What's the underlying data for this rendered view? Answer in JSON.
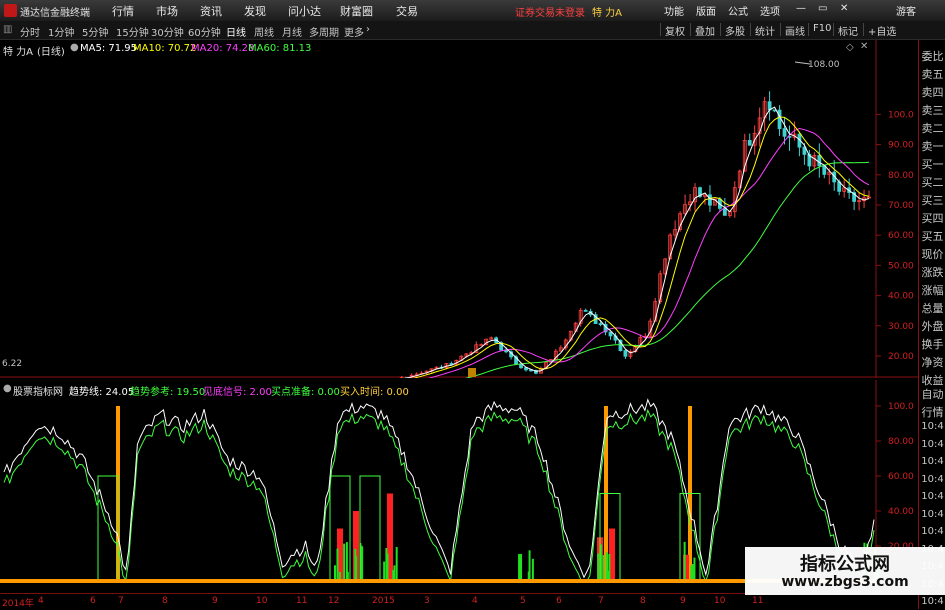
{
  "titlebar": {
    "app_name": "通达信金融终端",
    "menus": [
      "行情",
      "市场",
      "资讯",
      "发现",
      "问小达",
      "财富圈",
      "交易"
    ],
    "notice": "证券交易未登录",
    "stock_title": "特 力A",
    "right_menus": [
      "功能",
      "版面",
      "公式",
      "选项"
    ],
    "user": "游客"
  },
  "toolbar": {
    "periods": [
      "分时",
      "1分钟",
      "5分钟",
      "15分钟",
      "30分钟",
      "60分钟",
      "日线",
      "周线",
      "月线",
      "多周期",
      "更多"
    ],
    "active_period": "日线",
    "right_buttons": [
      "复权",
      "叠加",
      "多股",
      "统计",
      "画线",
      "F10",
      "标记",
      "+自选"
    ],
    "corner": "L"
  },
  "main_header": {
    "stock": "特 力A",
    "period": "(日线)",
    "ma5": "MA5: 71.95",
    "ma10": "MA10: 70.72",
    "ma20": "MA20: 74.28",
    "ma60": "MA60: 81.13",
    "colors": {
      "ma5": "#ffffff",
      "ma10": "#ffff00",
      "ma20": "#ff40ff",
      "ma60": "#40ff40"
    }
  },
  "main_axis": {
    "labels": [
      "100.0",
      "90.00",
      "80.00",
      "70.00",
      "60.00",
      "50.00",
      "40.00",
      "30.00",
      "20.00"
    ],
    "high_label": "108.00",
    "low_label": "6.22"
  },
  "sub_header": {
    "name": "股票指标网",
    "trend": "趋势线: 24.05",
    "ref": "趋势参考: 19.50",
    "bottom": "见底信号: 2.00",
    "buy_ready": "买点准备: 0.00",
    "buy_time": "买入时间: 0.00"
  },
  "sub_axis": {
    "labels": [
      "100.0",
      "80.00",
      "60.00",
      "40.00",
      "20.00"
    ]
  },
  "right_strip": {
    "items": [
      "委比",
      "卖五",
      "卖四",
      "卖三",
      "卖二",
      "卖一",
      "买一",
      "买二",
      "买三",
      "买四",
      "买五",
      "现价",
      "涨跌",
      "涨幅",
      "总量",
      "外盘",
      "换手",
      "净资",
      "收益"
    ],
    "lower_items": [
      "自动",
      "行情",
      "10:4",
      "10:4",
      "10:4",
      "10:4",
      "10:4",
      "10:4",
      "10:4",
      "10:4",
      "10:4",
      "10:4",
      "10:4"
    ]
  },
  "time_axis": {
    "labels": [
      "2014年",
      "4",
      "6",
      "7",
      "8",
      "9",
      "10",
      "11",
      "12",
      "2015",
      "3",
      "4",
      "5",
      "6",
      "7",
      "8",
      "9",
      "10",
      "11"
    ]
  },
  "watermark": {
    "line1": "指标公式网",
    "line2": "www.zbgs3.com"
  }
}
